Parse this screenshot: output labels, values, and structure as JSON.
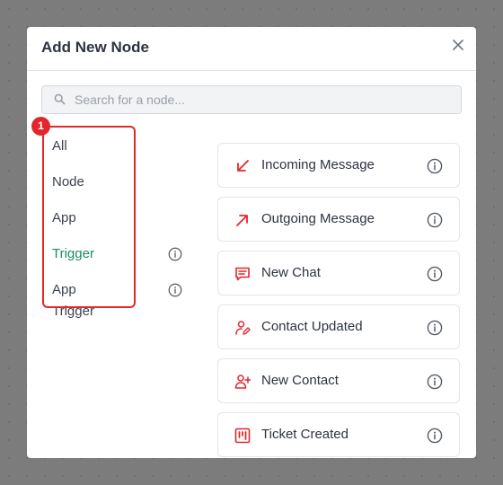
{
  "dialog": {
    "title": "Add New Node",
    "close_icon": "close-icon",
    "accent_color": "#1d8a6b",
    "icon_color": "#e3262c"
  },
  "search": {
    "placeholder": "Search for a node...",
    "value": "",
    "icon": "search-icon"
  },
  "annotation": {
    "badge": "1",
    "color": "#e3262c"
  },
  "categories": [
    {
      "label": "All",
      "active": false,
      "info": false
    },
    {
      "label": "Node",
      "active": false,
      "info": false
    },
    {
      "label": "App",
      "active": false,
      "info": false
    },
    {
      "label": "Trigger",
      "active": true,
      "info": true
    },
    {
      "label": "App Trigger",
      "active": false,
      "info": true
    }
  ],
  "nodes": [
    {
      "label": "Incoming Message",
      "icon": "arrow-down-left-icon"
    },
    {
      "label": "Outgoing Message",
      "icon": "arrow-up-right-icon"
    },
    {
      "label": "New Chat",
      "icon": "chat-icon"
    },
    {
      "label": "Contact Updated",
      "icon": "user-edit-icon"
    },
    {
      "label": "New Contact",
      "icon": "user-add-icon"
    },
    {
      "label": "Ticket Created",
      "icon": "ticket-board-icon"
    }
  ]
}
